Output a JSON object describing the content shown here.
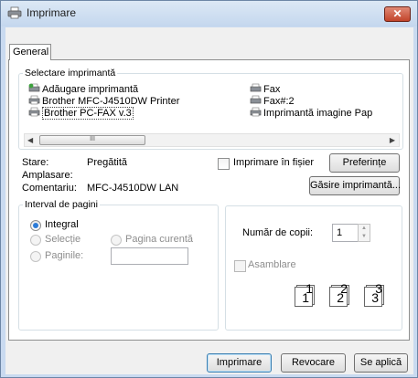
{
  "window": {
    "title": "Imprimare",
    "close_glyph": "✕"
  },
  "tabs": [
    {
      "label": "General"
    }
  ],
  "select_printer": {
    "legend": "Selectare imprimantă",
    "printers": [
      {
        "name": "Adăugare imprimantă",
        "icon": "add-printer-icon"
      },
      {
        "name": "Brother MFC-J4510DW Printer",
        "icon": "printer-icon"
      },
      {
        "name": "Brother PC-FAX v.3",
        "icon": "printer-icon",
        "selected": true
      },
      {
        "name": "Fax",
        "icon": "fax-icon"
      },
      {
        "name": "Fax#:2",
        "icon": "fax-icon"
      },
      {
        "name": "Imprimantă imagine Pap",
        "icon": "printer-icon"
      }
    ],
    "scroll_thumb_grip": "III",
    "scroll_left": "◀",
    "scroll_right": "▶"
  },
  "status": {
    "stare_label": "Stare:",
    "stare_value": "Pregătită",
    "amplasare_label": "Amplasare:",
    "amplasare_value": "",
    "comentariu_label": "Comentariu:",
    "comentariu_value": "MFC-J4510DW LAN",
    "print_to_file_label": "Imprimare în fișier",
    "preferences_button": "Preferințe",
    "find_printer_button": "Găsire imprimantă..."
  },
  "page_range": {
    "legend": "Interval de pagini",
    "all_label": "Integral",
    "selection_label": "Selecție",
    "current_page_label": "Pagina curentă",
    "pages_label": "Paginile:",
    "pages_value": ""
  },
  "copies": {
    "label": "Număr de copii:",
    "value": "1",
    "collate_label": "Asamblare",
    "collate_checked": false,
    "collate_pages": [
      {
        "back": "1",
        "front": "1"
      },
      {
        "back": "2",
        "front": "2"
      },
      {
        "back": "3",
        "front": "3"
      }
    ]
  },
  "buttons": {
    "print": "Imprimare",
    "cancel": "Revocare",
    "apply": "Se aplică"
  },
  "colors": {
    "title_bg": "#c9daf0",
    "close_red": "#c2442a",
    "accent_blue": "#2b7bd8"
  }
}
